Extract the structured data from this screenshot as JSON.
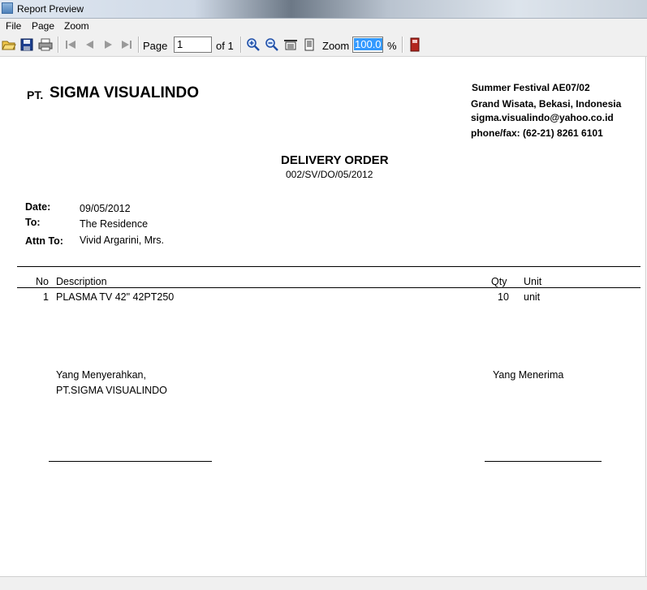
{
  "window": {
    "title": "Report Preview"
  },
  "menu": [
    "File",
    "Page",
    "Zoom"
  ],
  "toolbar": {
    "page_label": "Page",
    "page_value": "1",
    "page_of": "of 1",
    "zoom_label": "Zoom",
    "zoom_value": "100.0",
    "zoom_unit": "%"
  },
  "report": {
    "company_prefix": "PT.",
    "company_name": "SIGMA VISUALINDO",
    "address": [
      "Summer Festival AE07/02",
      "Grand Wisata, Bekasi, Indonesia",
      "sigma.visualindo@yahoo.co.id",
      "phone/fax: (62-21) 8261 6101"
    ],
    "doc_title": "DELIVERY ORDER",
    "doc_number": "002/SV/DO/05/2012",
    "fields": {
      "date_label": "Date:",
      "date_value": "09/05/2012",
      "to_label": "To:",
      "to_value": "The Residence",
      "attn_label": "Attn To:",
      "attn_value": "Vivid Argarini, Mrs."
    },
    "table": {
      "headers": {
        "no": "No",
        "description": "Description",
        "qty": "Qty",
        "unit": "Unit"
      },
      "rows": [
        {
          "no": "1",
          "description": "PLASMA TV 42\" 42PT250",
          "qty": "10",
          "unit": "unit"
        }
      ]
    },
    "signature": {
      "left_line1": "Yang Menyerahkan,",
      "left_line2": "PT.SIGMA VISUALINDO",
      "right_line1": "Yang Menerima"
    }
  }
}
